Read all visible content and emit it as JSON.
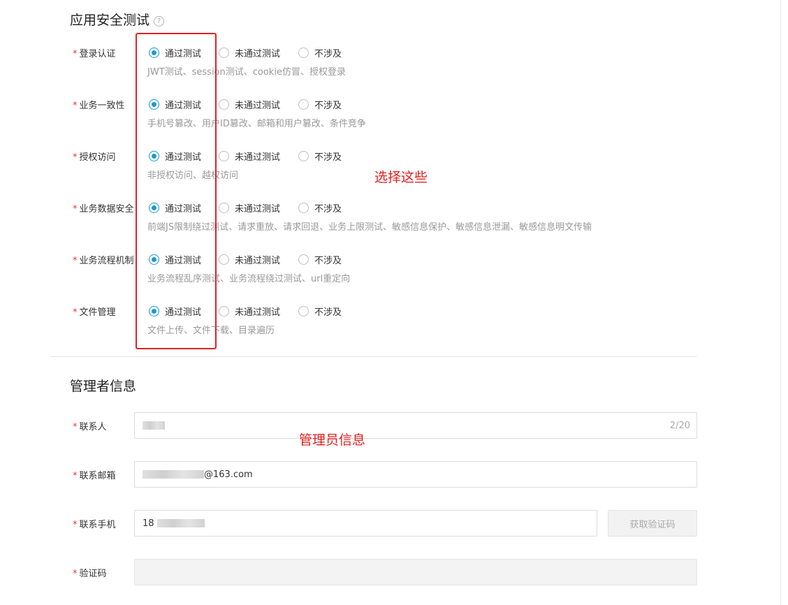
{
  "security_section": {
    "title": "应用安全测试",
    "help_glyph": "?"
  },
  "radio_options": [
    "通过测试",
    "未通过测试",
    "不涉及"
  ],
  "required_mark": "*",
  "tests": [
    {
      "label": "登录认证",
      "selected": 0,
      "hint": "JWT测试、session测试、cookie仿冒、授权登录"
    },
    {
      "label": "业务一致性",
      "selected": 0,
      "hint": "手机号篡改、用户ID篡改、邮箱和用户篡改、条件竞争"
    },
    {
      "label": "授权访问",
      "selected": 0,
      "hint": "非授权访问、越权访问"
    },
    {
      "label": "业务数据安全",
      "selected": 0,
      "hint": "前端JS限制绕过测试、请求重放、请求回退、业务上限测试、敏感信息保护、敏感信息泄漏、敏感信息明文传输"
    },
    {
      "label": "业务流程机制",
      "selected": 0,
      "hint": "业务流程乱序测试、业务流程绕过测试、url重定向"
    },
    {
      "label": "文件管理",
      "selected": 0,
      "hint": "文件上传、文件下载、目录遍历"
    }
  ],
  "annotations": {
    "select_these": "选择这些",
    "admin_info": "管理员信息"
  },
  "colors": {
    "accent": "#1a9ad6",
    "annotation_red": "#e52020",
    "required": "#e4393c"
  },
  "admin_section": {
    "title": "管理者信息",
    "contact_name": {
      "label": "联系人",
      "counter": "2/20"
    },
    "contact_email": {
      "label": "联系邮箱",
      "value_suffix": "@163.com"
    },
    "contact_phone": {
      "label": "联系手机",
      "value_prefix": "18",
      "button": "获取验证码"
    },
    "verify_code": {
      "label": "验证码"
    }
  }
}
